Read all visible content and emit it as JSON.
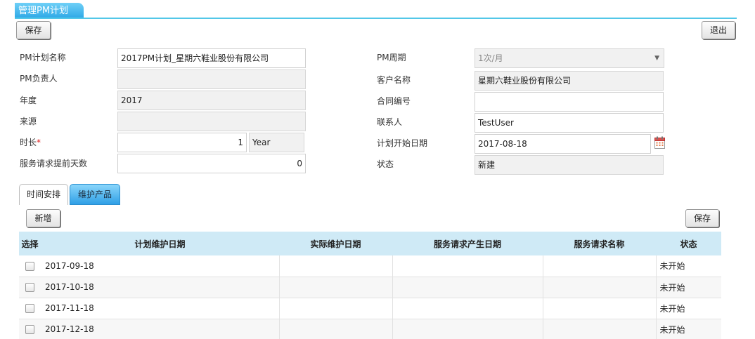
{
  "page": {
    "title": "管理PM计划"
  },
  "toolbar": {
    "save_label": "保存",
    "exit_label": "退出"
  },
  "form": {
    "plan_name": {
      "label": "PM计划名称",
      "value": "2017PM计划_星期六鞋业股份有限公司"
    },
    "owner": {
      "label": "PM负责人",
      "value": ""
    },
    "year": {
      "label": "年度",
      "value": "2017"
    },
    "source": {
      "label": "来源",
      "value": ""
    },
    "duration": {
      "label": "时长",
      "required_mark": "*",
      "value": "1",
      "unit": "Year"
    },
    "advance_days": {
      "label": "服务请求提前天数",
      "value": "0"
    },
    "cycle": {
      "label": "PM周期",
      "value": "1次/月"
    },
    "customer": {
      "label": "客户名称",
      "value": "星期六鞋业股份有限公司"
    },
    "contract_no": {
      "label": "合同编号",
      "value": ""
    },
    "contact": {
      "label": "联系人",
      "value": "TestUser"
    },
    "start_date": {
      "label": "计划开始日期",
      "value": "2017-08-18"
    },
    "status": {
      "label": "状态",
      "value": "新建"
    }
  },
  "tabs": [
    {
      "label": "时间安排",
      "active": true
    },
    {
      "label": "维护产品",
      "active": false
    }
  ],
  "schedule": {
    "add_label": "新增",
    "save_label": "保存",
    "columns": [
      "选择",
      "计划维护日期",
      "实际维护日期",
      "服务请求产生日期",
      "服务请求名称",
      "状态"
    ],
    "rows": [
      {
        "planned": "2017-09-18",
        "actual": "",
        "request_date": "",
        "request_name": "",
        "status": "未开始"
      },
      {
        "planned": "2017-10-18",
        "actual": "",
        "request_date": "",
        "request_name": "",
        "status": "未开始"
      },
      {
        "planned": "2017-11-18",
        "actual": "",
        "request_date": "",
        "request_name": "",
        "status": "未开始"
      },
      {
        "planned": "2017-12-18",
        "actual": "",
        "request_date": "",
        "request_name": "",
        "status": "未开始"
      }
    ]
  }
}
